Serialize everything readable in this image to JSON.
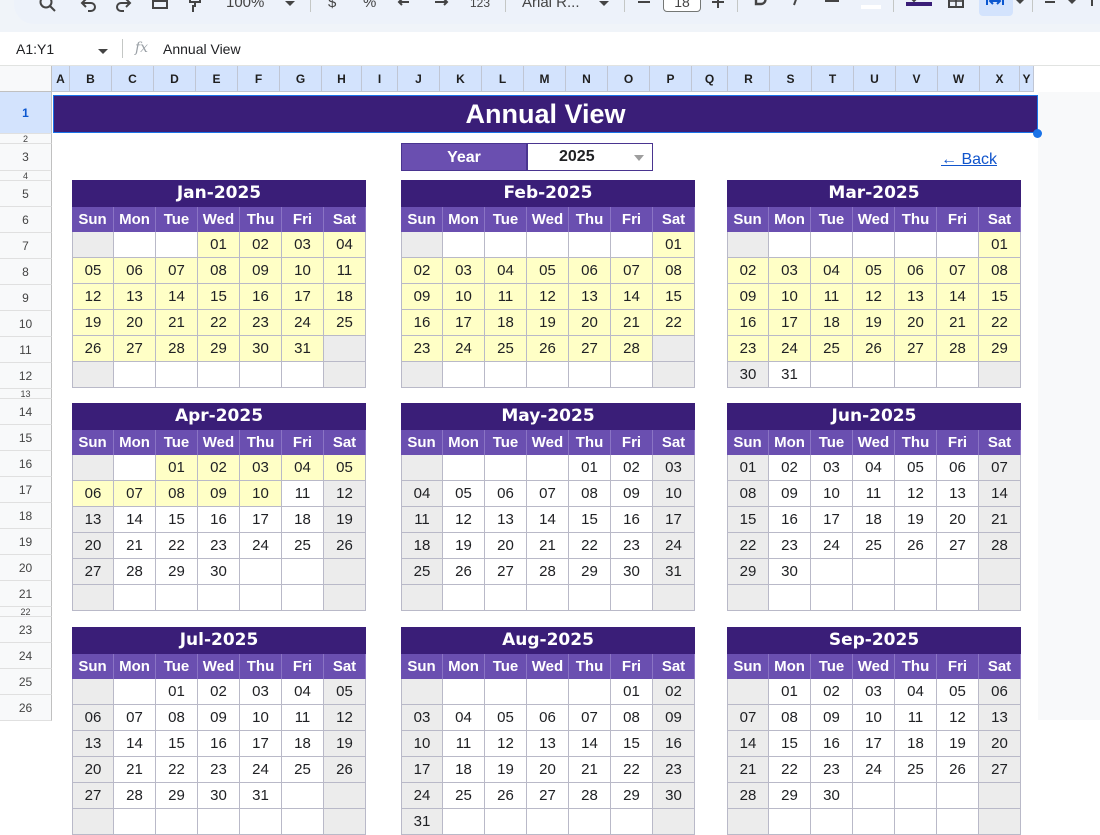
{
  "toolbar": {
    "zoom": "100%",
    "currency": "$",
    "percent": "%",
    "decimals_format": "123",
    "font_name": "Arial R...",
    "font_size": "18"
  },
  "formula_bar": {
    "cell_ref": "A1:Y1",
    "fx_label": "fx",
    "value": "Annual View"
  },
  "columns": [
    "A",
    "B",
    "C",
    "D",
    "E",
    "F",
    "G",
    "H",
    "I",
    "J",
    "K",
    "L",
    "M",
    "N",
    "O",
    "P",
    "Q",
    "R",
    "S",
    "T",
    "U",
    "V",
    "W",
    "X",
    "Y"
  ],
  "rows": [
    "1",
    "2",
    "3",
    "4",
    "5",
    "6",
    "7",
    "8",
    "9",
    "10",
    "11",
    "12",
    "13",
    "14",
    "15",
    "16",
    "17",
    "18",
    "19",
    "20",
    "21",
    "22",
    "23",
    "24",
    "25",
    "26"
  ],
  "sheet": {
    "title": "Annual View",
    "year_label": "Year",
    "year_value": "2025",
    "back_link": "← Back"
  },
  "weekdays": [
    "Sun",
    "Mon",
    "Tue",
    "Wed",
    "Thu",
    "Fri",
    "Sat"
  ],
  "months": [
    {
      "title": "Jan-2025",
      "first_day": 3,
      "days": 31,
      "hl_to": 31
    },
    {
      "title": "Feb-2025",
      "first_day": 6,
      "days": 28,
      "hl_to": 28
    },
    {
      "title": "Mar-2025",
      "first_day": 6,
      "days": 31,
      "hl_to": 29
    },
    {
      "title": "Apr-2025",
      "first_day": 2,
      "days": 30,
      "hl_to": 10
    },
    {
      "title": "May-2025",
      "first_day": 4,
      "days": 31,
      "hl_to": 0
    },
    {
      "title": "Jun-2025",
      "first_day": 0,
      "days": 30,
      "hl_to": 0
    },
    {
      "title": "Jul-2025",
      "first_day": 2,
      "days": 31,
      "hl_to": 0
    },
    {
      "title": "Aug-2025",
      "first_day": 5,
      "days": 31,
      "hl_to": 0
    },
    {
      "title": "Sep-2025",
      "first_day": 1,
      "days": 30,
      "hl_to": 0
    }
  ]
}
